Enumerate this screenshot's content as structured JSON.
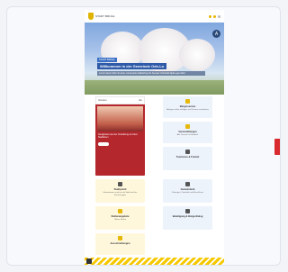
{
  "header": {
    "brand": "STADT BRÜHL",
    "lang": "DE",
    "search_icon": "search-icon",
    "menu_icon": "menu-icon"
  },
  "hero": {
    "tag": "STADT BRÜHL",
    "title": "Willkommen in der Gemeinde Oeb-Lo",
    "subtitle": "Lorem ipsum dolor sit amet, consectetur adipiscing elit. Aenean commodo ligula eget dolor.",
    "badge": "A"
  },
  "news": {
    "header_left": "Aktuelles",
    "header_right": "Alle",
    "text": "Neuigkeiten aus der Verwaltung und dem Stadtleben",
    "footer": "Mehr lesen"
  },
  "tiles": [
    {
      "label": "Bürgerservice",
      "desc": "Anliegen online erledigen und Termine vereinbaren",
      "icon": "document-icon"
    },
    {
      "label": "Veranstaltungen",
      "desc": "Alle Termine im Überblick",
      "icon": "calendar-icon"
    },
    {
      "label": "Tourismus & Freizeit",
      "desc": "",
      "icon": "map-icon"
    },
    {
      "label": "Stadtportal",
      "desc": "Informationen rund um die Stadt und ihre Einrichtungen",
      "icon": "building-icon"
    },
    {
      "label": "Gemeinderat",
      "desc": "Sitzungen, Protokolle und Beschlüsse",
      "icon": "people-icon"
    },
    {
      "label": "Stellenangebote",
      "desc": "Offene Stellen",
      "icon": "briefcase-icon"
    },
    {
      "label": "Beteiligung & Bürgerdialog",
      "desc": "",
      "icon": "chat-icon"
    },
    {
      "label": "Ausschreibungen",
      "desc": "",
      "icon": "clipboard-icon"
    }
  ],
  "colors": {
    "accent": "#e7b80c",
    "news_red": "#b3272d",
    "hero_blue": "#2e5aa8",
    "side_tab": "#d92b2f"
  }
}
